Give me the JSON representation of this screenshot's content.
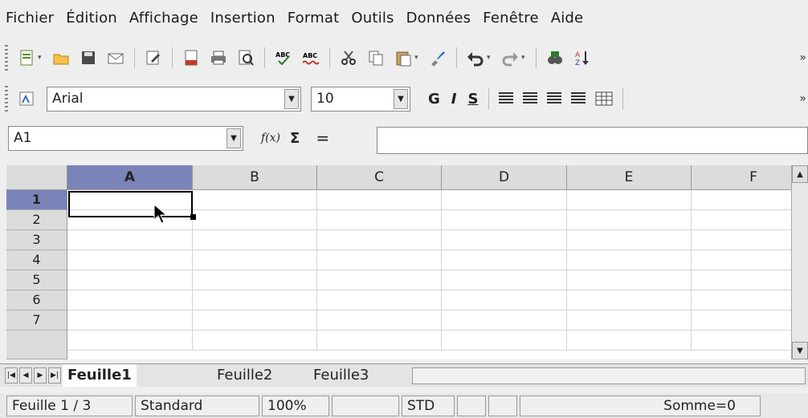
{
  "menu": [
    {
      "label": "Fichier"
    },
    {
      "label": "Édition"
    },
    {
      "label": "Affichage"
    },
    {
      "label": "Insertion"
    },
    {
      "label": "Format"
    },
    {
      "label": "Outils"
    },
    {
      "label": "Données"
    },
    {
      "label": "Fenêtre"
    },
    {
      "label": "Aide"
    }
  ],
  "format_toolbar": {
    "font_name": "Arial",
    "font_size": "10",
    "bold": "G",
    "italic": "I",
    "underline": "S"
  },
  "formula_bar": {
    "cell_ref": "A1",
    "fx": "f(x)",
    "sum": "Σ",
    "equals": "=",
    "value": ""
  },
  "grid": {
    "columns": [
      "A",
      "B",
      "C",
      "D",
      "E",
      "F"
    ],
    "rows": [
      "1",
      "2",
      "3",
      "4",
      "5",
      "6",
      "7"
    ],
    "selected_column": "A",
    "selected_row": "1"
  },
  "sheets": [
    {
      "label": "Feuille1",
      "active": true
    },
    {
      "label": "Feuille2",
      "active": false
    },
    {
      "label": "Feuille3",
      "active": false
    }
  ],
  "status": {
    "sheet": "Feuille 1 / 3",
    "style": "Standard",
    "zoom": "100%",
    "mode": "STD",
    "sum": "Somme=0"
  },
  "colors": {
    "selected_header": "#7a84b8",
    "background": "#efefef"
  }
}
